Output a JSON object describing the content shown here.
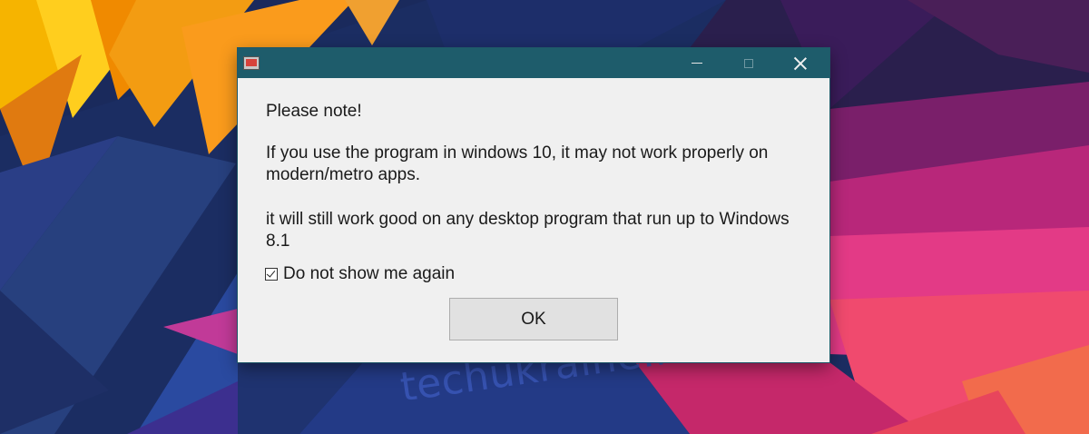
{
  "dialog": {
    "title": "",
    "heading": "Please note!",
    "paragraph1": "If you use the program in windows 10, it may not work properly on modern/metro apps.",
    "paragraph2": "it will still work good on any desktop program that run up to Windows 8.1",
    "checkbox_label": "Do not show me again",
    "checkbox_checked": true,
    "ok_label": "OK"
  },
  "titlebar_icons": {
    "app": "app-icon",
    "minimize": "minimize-icon",
    "maximize": "maximize-icon",
    "close": "close-icon"
  },
  "watermark": "techukraine.net",
  "colors": {
    "titlebar": "#1e5c6b",
    "dialog_bg": "#f0f0f0",
    "button_bg": "#e1e1e1"
  }
}
